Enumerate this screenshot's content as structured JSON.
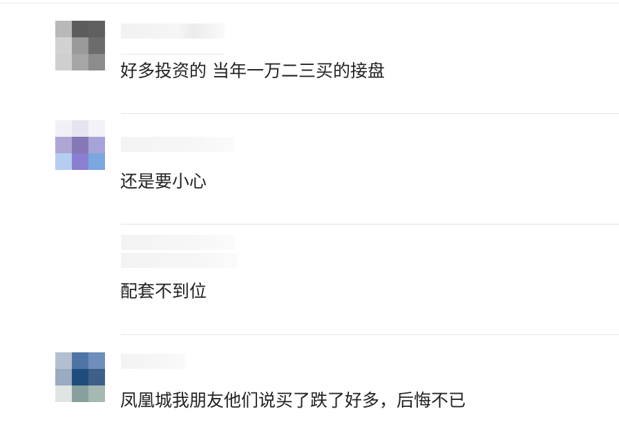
{
  "comments": [
    {
      "text": "好多投资的 当年一万二三买的接盘",
      "avatar_colors": [
        "#b9b9b9",
        "#5c5c5c",
        "#606060",
        "#d2d2d2",
        "#9a9a9a",
        "#6c6c6c",
        "#cfcfcf",
        "#a6a6a6",
        "#8c8c8c"
      ]
    },
    {
      "text": "还是要小心",
      "avatar_colors": [
        "#f1f0f6",
        "#e6e4f0",
        "#f3f2f8",
        "#b0a6d6",
        "#8578b5",
        "#a5a3d8",
        "#b5cdf0",
        "#8a7fd0",
        "#7aa7e0"
      ]
    },
    {
      "text": "配套不到位"
    },
    {
      "text": "凤凰城我朋友他们说买了跌了好多，后悔不已",
      "avatar_colors": [
        "#b3bfce",
        "#4f73a5",
        "#6e8fbd",
        "#9aaac0",
        "#1f4c7c",
        "#3e5f88",
        "#dfe5e4",
        "#88a09d",
        "#a6b8b4"
      ]
    }
  ]
}
